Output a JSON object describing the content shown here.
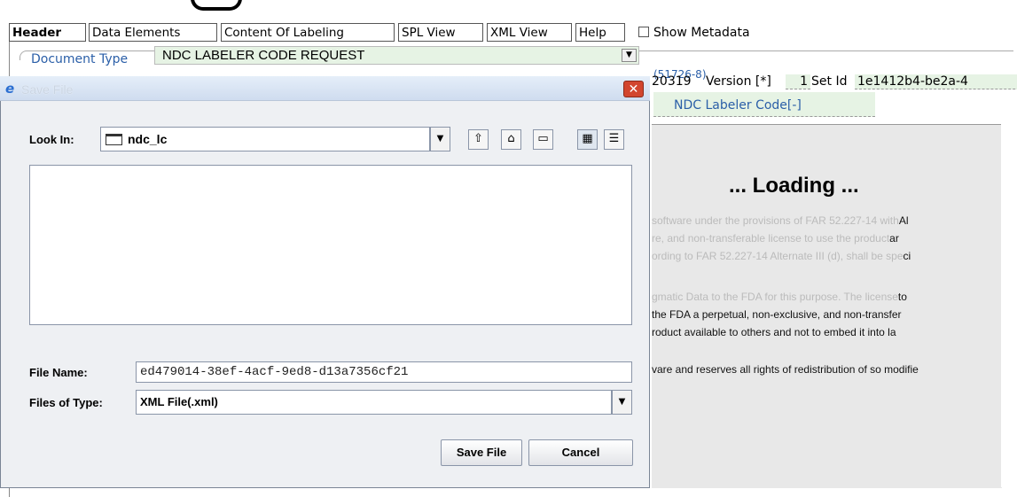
{
  "tabs": [
    {
      "label": "Header",
      "active": true
    },
    {
      "label": "Data Elements",
      "active": false
    },
    {
      "label": "Content Of Labeling",
      "active": false
    },
    {
      "label": "SPL View",
      "active": false
    },
    {
      "label": "XML View",
      "active": false
    },
    {
      "label": "Help",
      "active": false
    }
  ],
  "show_metadata_label": "Show Metadata",
  "document_type": {
    "label": "Document Type",
    "value": "NDC LABELER CODE REQUEST",
    "code": "(51726-8)"
  },
  "meta": {
    "date_fragment": "20319",
    "version_label": "Version [*]",
    "version_value": "1",
    "setid_label": "Set Id",
    "setid_value": "1e1412b4-be2a-4",
    "ndc_labeler_code": "NDC Labeler Code[-]"
  },
  "loading": {
    "title": "... Loading ...",
    "license_lines": [
      {
        "faded": "software under the provisions of FAR 52.227-14 with",
        "dark": "Al"
      },
      {
        "faded": "re, and non-transferable license to use the product",
        "dark": "ar"
      },
      {
        "faded": "ording to FAR 52.227-14 Alternate III (d), shall be spe",
        "dark": "ci"
      },
      {
        "faded": "gmatic Data to the FDA for this purpose. The license",
        "dark": "to"
      },
      {
        "faded": "",
        "dark": "the FDA a perpetual, non-exclusive, and non-transfer"
      },
      {
        "faded": "",
        "dark": "roduct available to others and not to embed it into la"
      },
      {
        "faded": "",
        "dark": "vare and reserves all rights of redistribution of so modifie"
      }
    ]
  },
  "dialog": {
    "title": "Save File",
    "close_glyph": "✕",
    "look_in_label": "Look In:",
    "look_in_value": "ndc_lc",
    "file_name_label": "File Name:",
    "file_name_value": "ed479014-38ef-4acf-9ed8-d13a7356cf21",
    "files_of_type_label": "Files of Type:",
    "files_of_type_value": "XML File(.xml)",
    "save_button": "Save File",
    "cancel_button": "Cancel"
  },
  "colors": {
    "accent_blue": "#2b5fa8",
    "field_green": "#e6f3e4",
    "close_red": "#d2452e"
  }
}
